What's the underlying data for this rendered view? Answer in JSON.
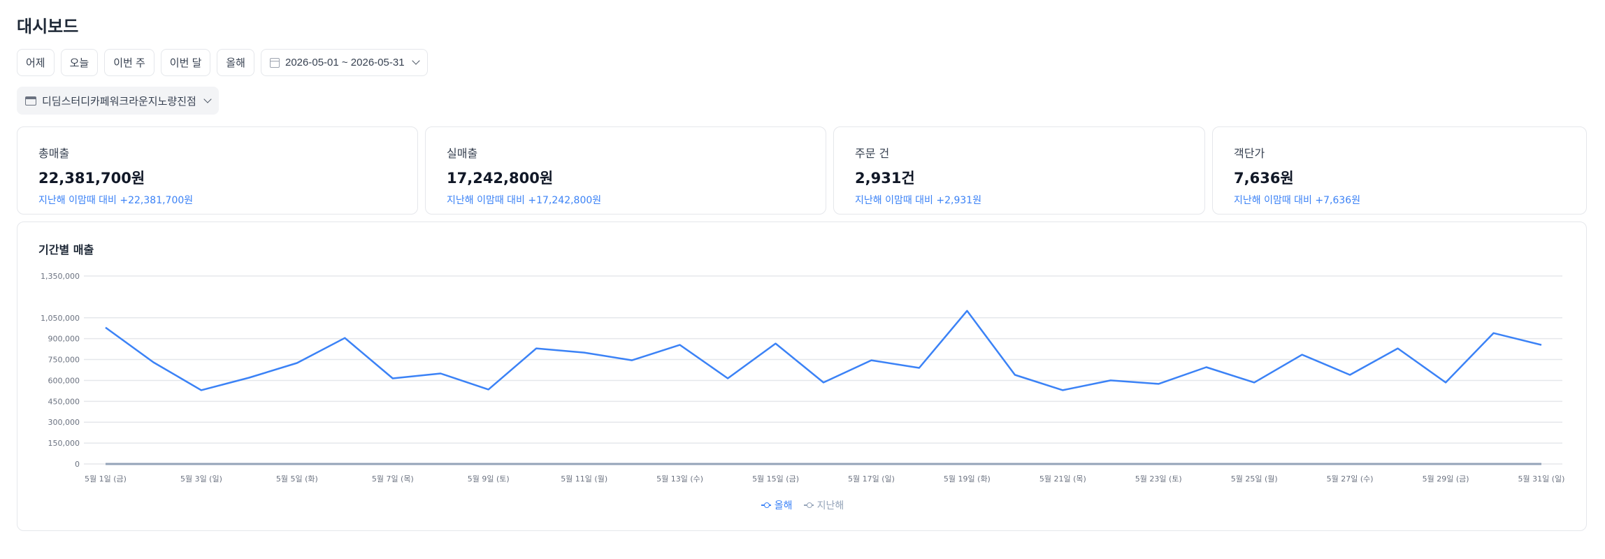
{
  "page": {
    "title": "대시보드"
  },
  "filters": {
    "buttons": [
      "어제",
      "오늘",
      "이번 주",
      "이번 달",
      "올해"
    ],
    "date_range": "2026-05-01 ~ 2026-05-31"
  },
  "store": {
    "name": "디딤스터디카페워크라운지노량진점"
  },
  "kpis": [
    {
      "label": "총매출",
      "value": "22,381,700원",
      "delta": "지난해 이맘때 대비 +22,381,700원"
    },
    {
      "label": "실매출",
      "value": "17,242,800원",
      "delta": "지난해 이맘때 대비 +17,242,800원"
    },
    {
      "label": "주문 건",
      "value": "2,931건",
      "delta": "지난해 이맘때 대비 +2,931원"
    },
    {
      "label": "객단가",
      "value": "7,636원",
      "delta": "지난해 이맘때 대비 +7,636원"
    }
  ],
  "chart": {
    "title": "기간별 매출"
  },
  "colors": {
    "this_year": "#3b82f6",
    "last_year": "#94a3b8",
    "accent": "#3b82f6"
  },
  "chart_data": {
    "type": "line",
    "title": "",
    "xlabel": "",
    "ylabel": "",
    "ylim": [
      0,
      1350000
    ],
    "y_ticks": [
      0,
      150000,
      300000,
      450000,
      600000,
      750000,
      900000,
      1050000,
      1350000
    ],
    "y_tick_labels": [
      "0",
      "150,000",
      "300,000",
      "450,000",
      "600,000",
      "750,000",
      "900,000",
      "1,050,000",
      "1,350,000"
    ],
    "grid": true,
    "legend_position": "bottom-center",
    "x": [
      "5월 1일 (금)",
      "5월 2일 (토)",
      "5월 3일 (일)",
      "5월 4일 (월)",
      "5월 5일 (화)",
      "5월 6일 (수)",
      "5월 7일 (목)",
      "5월 8일 (금)",
      "5월 9일 (토)",
      "5월 10일 (일)",
      "5월 11일 (월)",
      "5월 12일 (화)",
      "5월 13일 (수)",
      "5월 14일 (목)",
      "5월 15일 (금)",
      "5월 16일 (토)",
      "5월 17일 (일)",
      "5월 18일 (월)",
      "5월 19일 (화)",
      "5월 20일 (수)",
      "5월 21일 (목)",
      "5월 22일 (금)",
      "5월 23일 (토)",
      "5월 24일 (일)",
      "5월 25일 (월)",
      "5월 26일 (화)",
      "5월 27일 (수)",
      "5월 28일 (목)",
      "5월 29일 (금)",
      "5월 30일 (토)",
      "5월 31일 (일)"
    ],
    "x_labels_shown": [
      "5월 1일 (금)",
      "5월 3일 (일)",
      "5월 5일 (화)",
      "5월 7일 (목)",
      "5월 9일 (토)",
      "5월 11일 (월)",
      "5월 13일 (수)",
      "5월 15일 (금)",
      "5월 17일 (일)",
      "5월 19일 (화)",
      "5월 21일 (목)",
      "5월 23일 (토)",
      "5월 25일 (월)",
      "5월 27일 (수)",
      "5월 29일 (금)",
      "5월 31일 (일)"
    ],
    "series": [
      {
        "name": "올해",
        "values": [
          980000,
          730000,
          530000,
          620000,
          725000,
          905000,
          615000,
          650000,
          535000,
          830000,
          800000,
          745000,
          855000,
          615000,
          865000,
          585000,
          745000,
          690000,
          1100000,
          640000,
          530000,
          600000,
          575000,
          695000,
          585000,
          785000,
          640000,
          830000,
          585000,
          940000,
          855000
        ]
      },
      {
        "name": "지난해",
        "values": [
          0,
          0,
          0,
          0,
          0,
          0,
          0,
          0,
          0,
          0,
          0,
          0,
          0,
          0,
          0,
          0,
          0,
          0,
          0,
          0,
          0,
          0,
          0,
          0,
          0,
          0,
          0,
          0,
          0,
          0,
          0
        ]
      }
    ]
  }
}
